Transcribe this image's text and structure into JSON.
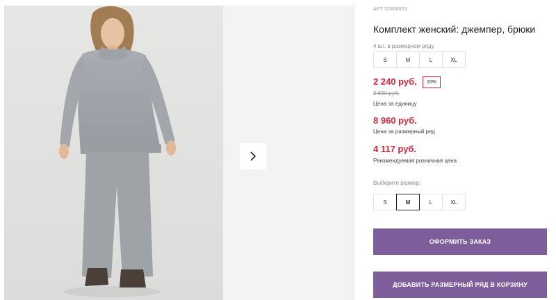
{
  "product": {
    "article": "АРТ 32466003",
    "title": "Комплект женский: джемпер, брюки",
    "sizes_note": "4 шт. в размерном ряду",
    "sizes_in_row": [
      "S",
      "M",
      "L",
      "XL"
    ]
  },
  "pricing": {
    "unit_price": "2 240 руб.",
    "discount_badge": "15%",
    "old_price": "2 630 руб.",
    "unit_label": "Цена за единицу",
    "row_price": "8 960 руб.",
    "row_label": "Цена за размерный ряд",
    "retail_price": "4 117 руб.",
    "retail_label": "Рекомендуемая розничная цена",
    "accent_color": "#d4283c"
  },
  "size_selector": {
    "label": "Выберите размер:",
    "options": [
      "S",
      "M",
      "L",
      "XL"
    ],
    "selected": "M"
  },
  "actions": {
    "order_label": "ОФОРМИТЬ ЗАКАЗ",
    "add_to_cart_label": "ДОБАВИТЬ РАЗМЕРНЫЙ РЯД В КОРЗИНУ",
    "button_color": "#7d5d9a"
  },
  "gallery": {
    "next_icon": "chevron-right-icon"
  }
}
